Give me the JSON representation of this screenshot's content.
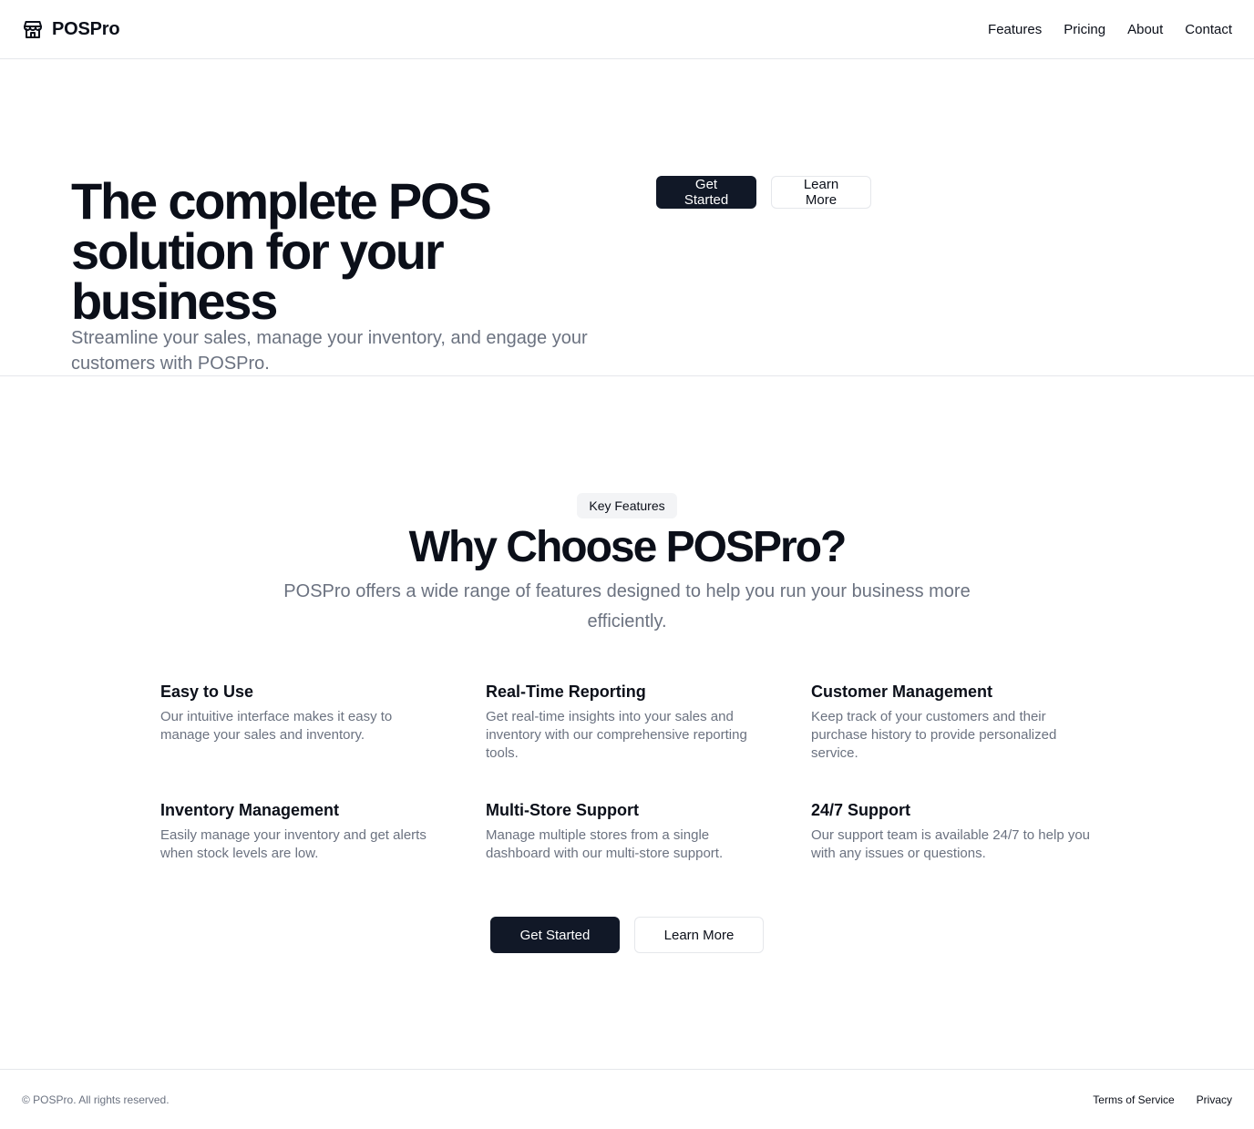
{
  "header": {
    "brand": "POSPro",
    "logo_icon": "storefront-icon",
    "nav": [
      "Features",
      "Pricing",
      "About",
      "Contact"
    ]
  },
  "hero": {
    "title": "The complete POS solution for your business",
    "subtitle": "Streamline your sales, manage your inventory, and engage your customers with POSPro.",
    "primary_button": "Get Started",
    "secondary_button": "Learn More"
  },
  "features": {
    "badge": "Key Features",
    "title": "Why Choose POSPro?",
    "subtitle": "POSPro offers a wide range of features designed to help you run your business more efficiently.",
    "items": [
      {
        "title": "Easy to Use",
        "description": "Our intuitive interface makes it easy to manage your sales and inventory."
      },
      {
        "title": "Real-Time Reporting",
        "description": "Get real-time insights into your sales and inventory with our comprehensive reporting tools."
      },
      {
        "title": "Customer Management",
        "description": "Keep track of your customers and their purchase history to provide personalized service."
      },
      {
        "title": "Inventory Management",
        "description": "Easily manage your inventory and get alerts when stock levels are low."
      },
      {
        "title": "Multi-Store Support",
        "description": "Manage multiple stores from a single dashboard with our multi-store support."
      },
      {
        "title": "24/7 Support",
        "description": "Our support team is available 24/7 to help you with any issues or questions."
      }
    ],
    "primary_button": "Get Started",
    "secondary_button": "Learn More"
  },
  "footer": {
    "copyright": "© POSPro. All rights reserved.",
    "links": [
      "Terms of Service",
      "Privacy"
    ]
  },
  "colors": {
    "primary_dark": "#111827",
    "text_muted": "#6b7280",
    "border": "#e5e7eb",
    "badge_bg": "#f3f4f6"
  }
}
